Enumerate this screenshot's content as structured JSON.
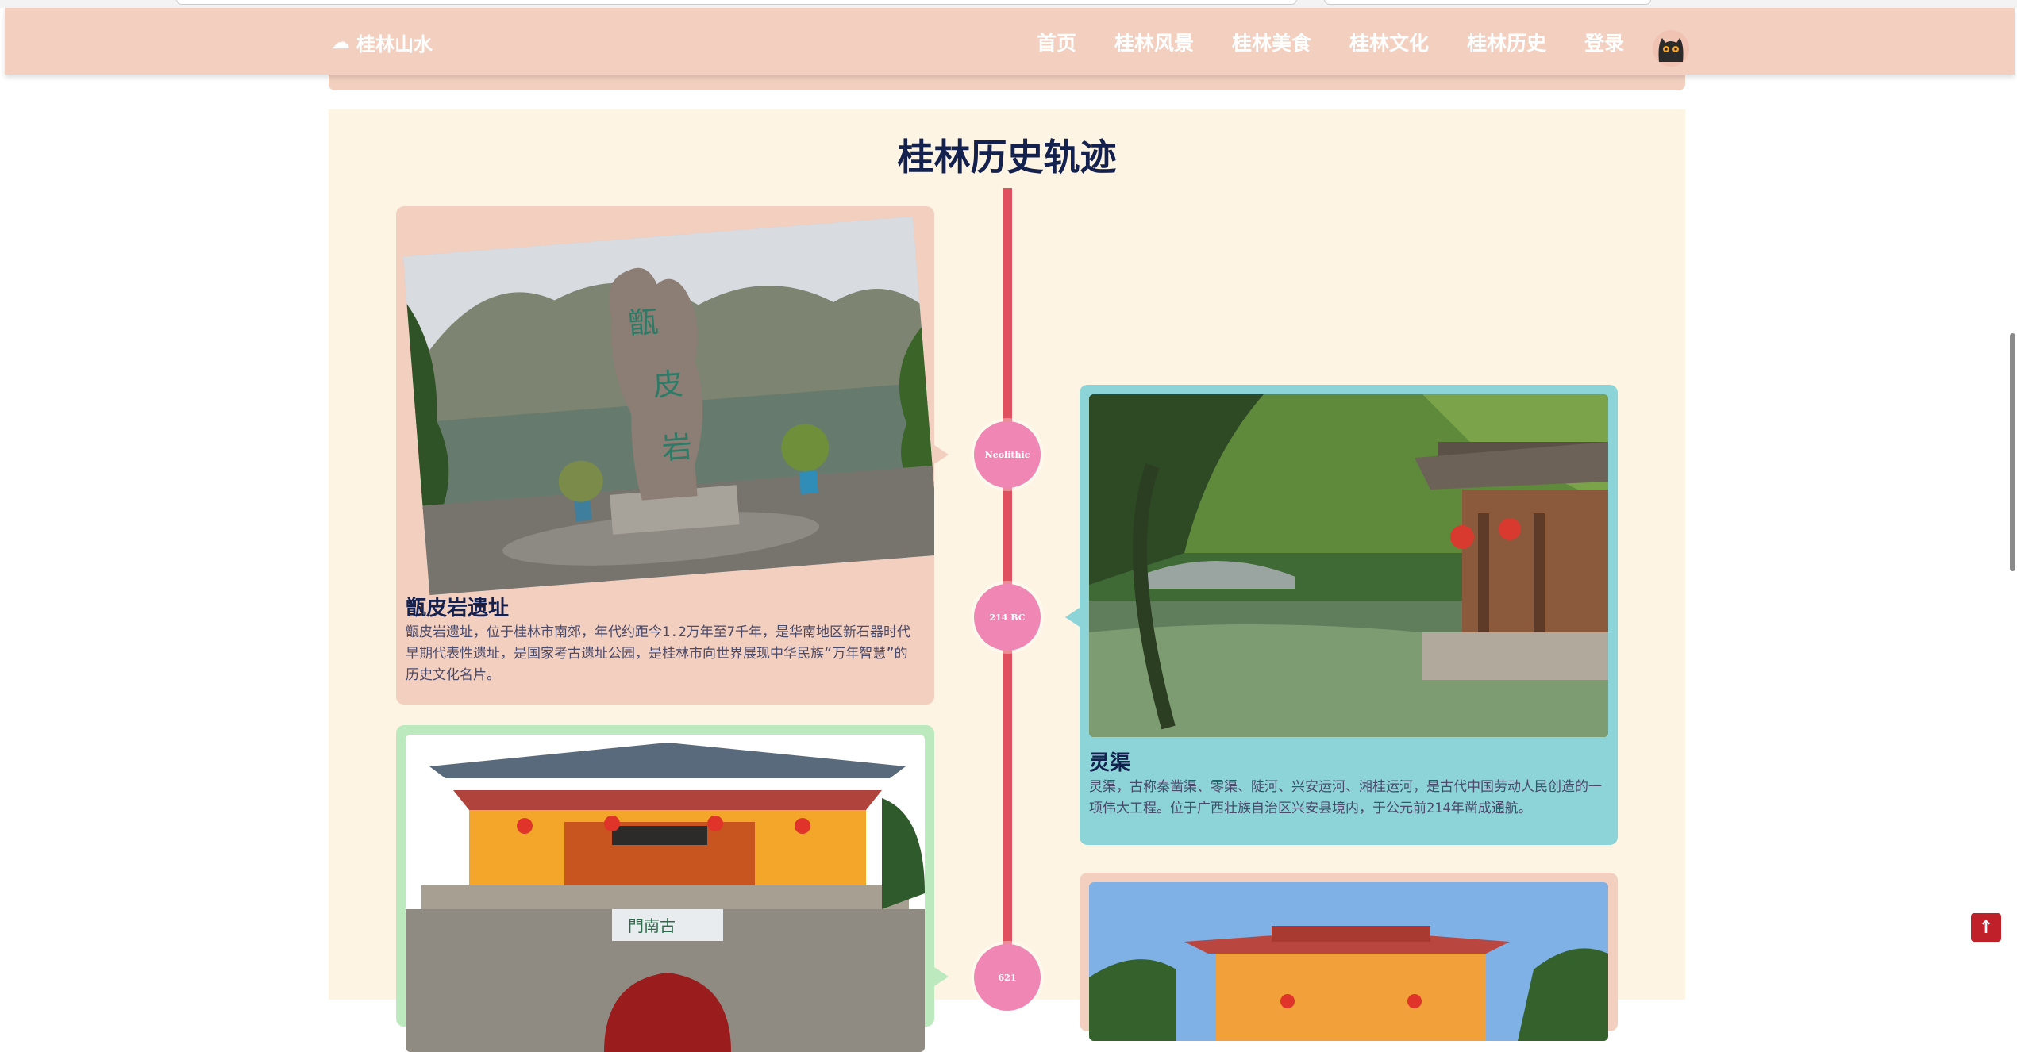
{
  "navbar": {
    "brand": "桂林山水",
    "links": [
      "首页",
      "桂林风景",
      "桂林美食",
      "桂林文化",
      "桂林历史",
      "登录"
    ]
  },
  "timeline": {
    "title": "桂林历史轨迹",
    "markers": [
      "Neolithic",
      "214 BC",
      "621"
    ],
    "cards": [
      {
        "title": "甑皮岩遗址",
        "desc": "甑皮岩遗址，位于桂林市南郊，年代约距今1.2万年至7千年，是华南地区新石器时代 早期代表性遗址，是国家考古遗址公园，是桂林市向世界展现中华民族“万年智慧”的 历史文化名片。",
        "stone_text": "甑皮岩"
      },
      {
        "title": "灵渠",
        "desc": "灵渠，古称秦凿渠、零渠、陡河、兴安运河、湘桂运河，是古代中国劳动人民创造的一项伟大工程。位于广西壮族自治区兴安县境内，于公元前214年凿成通航。"
      },
      {
        "gate_text": "門南古"
      }
    ]
  },
  "colors": {
    "nav_bg": "#f3cfc0",
    "section_bg": "#fdf4e3",
    "timeline_line": "#e0505f",
    "marker": "#ef86b4",
    "card_peach": "#f3cfc0",
    "card_teal": "#8dd4d9",
    "card_green": "#bde9be",
    "title": "#14204d"
  },
  "icons": {
    "brand": "cloud-icon",
    "back_to_top": "arrow-up-icon"
  }
}
